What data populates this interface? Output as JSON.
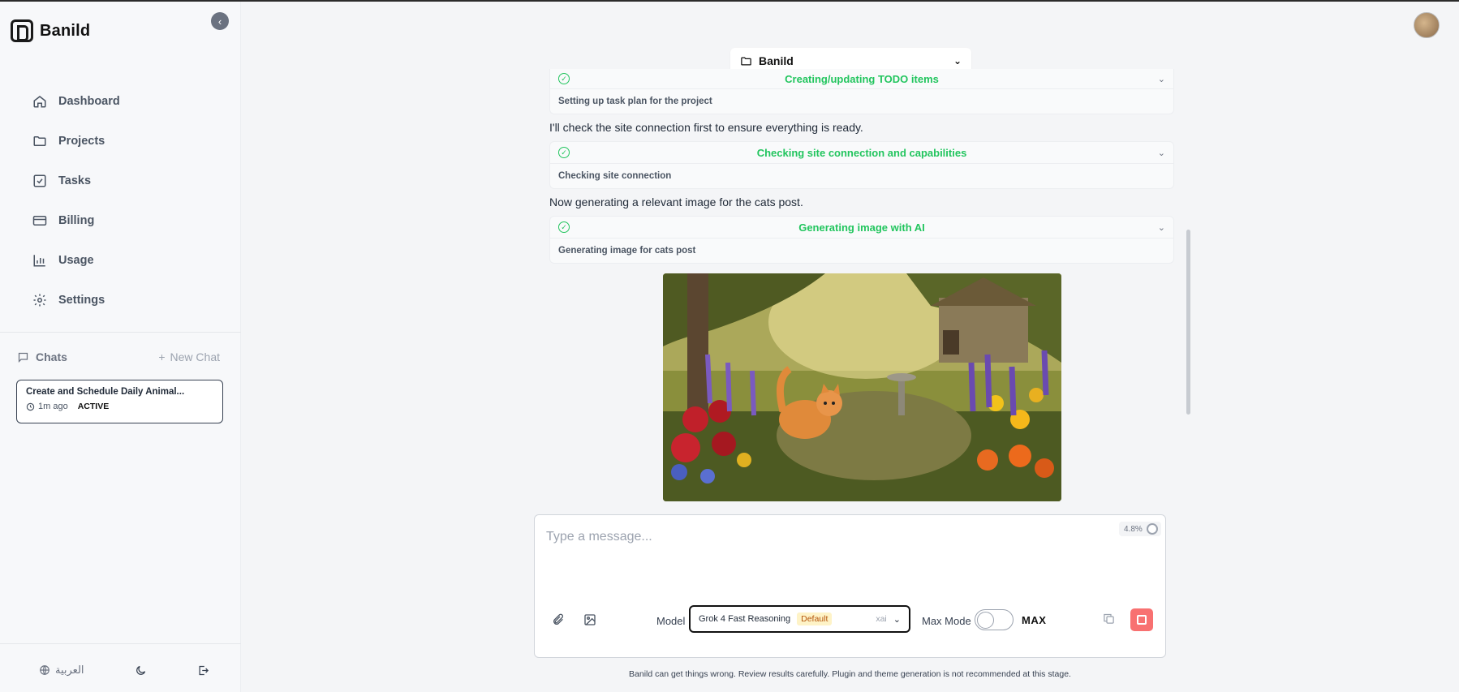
{
  "app": {
    "name": "Banild"
  },
  "sidebar": {
    "items": [
      {
        "label": "Dashboard",
        "icon": "home-icon"
      },
      {
        "label": "Projects",
        "icon": "folder-icon"
      },
      {
        "label": "Tasks",
        "icon": "checkbox-icon"
      },
      {
        "label": "Billing",
        "icon": "credit-card-icon"
      },
      {
        "label": "Usage",
        "icon": "bar-chart-icon"
      },
      {
        "label": "Settings",
        "icon": "gear-icon"
      }
    ],
    "chats_label": "Chats",
    "new_chat_label": "New Chat",
    "chat": {
      "title": "Create and Schedule Daily Animal...",
      "time": "1m ago",
      "status": "ACTIVE"
    },
    "footer": {
      "language": "العربية"
    }
  },
  "project_selector": {
    "name": "Banild"
  },
  "conversation": {
    "tools": [
      {
        "title": "Creating/updating TODO items",
        "detail": "Setting up task plan for the project"
      },
      {
        "title": "Checking site connection and capabilities",
        "detail": "Checking site connection"
      },
      {
        "title": "Generating image with AI",
        "detail": "Generating image for cats post"
      }
    ],
    "messages": [
      "I'll check the site connection first to ensure everything is ready.",
      "Now generating a relevant image for the cats post."
    ]
  },
  "composer": {
    "placeholder": "Type a message...",
    "context_usage": "4.8%",
    "model_label": "Model",
    "model_name": "Grok 4 Fast Reasoning",
    "model_badge": "Default",
    "model_provider": "xai",
    "max_mode_label": "Max Mode",
    "max_text": "MAX"
  },
  "disclaimer": "Banild can get things wrong. Review results carefully. Plugin and theme generation is not recommended at this stage.",
  "colors": {
    "accent_green": "#22c55e",
    "stop_red": "#f87171",
    "badge_amber": "#b45309"
  }
}
